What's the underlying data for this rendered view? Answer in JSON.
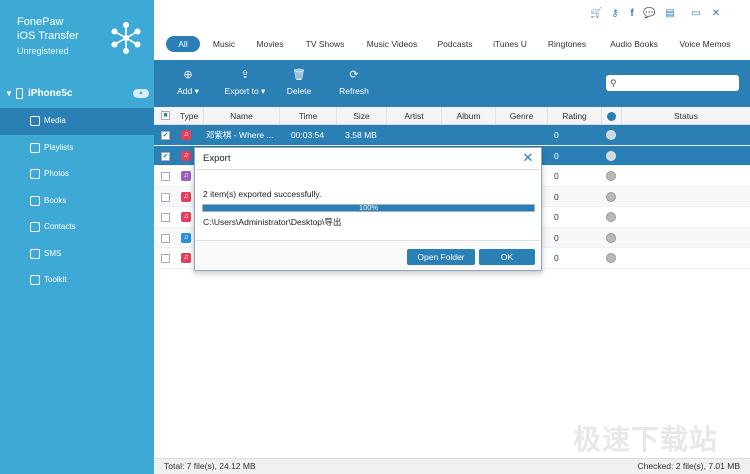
{
  "app": {
    "name_line1": "FonePaw",
    "name_line2": "iOS Transfer",
    "registration": "Unregistered"
  },
  "window_controls": [
    {
      "name": "cart-icon",
      "glyph": "🛒"
    },
    {
      "name": "key-icon",
      "glyph": "⚷"
    },
    {
      "name": "facebook-icon",
      "glyph": "f"
    },
    {
      "name": "chat-icon",
      "glyph": "💬"
    },
    {
      "name": "menu-icon",
      "glyph": "▤"
    },
    {
      "name": "minimize-icon",
      "glyph": "▭"
    },
    {
      "name": "close-window-icon",
      "glyph": "✕"
    }
  ],
  "device": {
    "name": "iPhone5c"
  },
  "sidebar": {
    "items": [
      {
        "label": "Media",
        "icon": "music-icon",
        "active": true
      },
      {
        "label": "Playlists",
        "icon": "playlist-icon",
        "active": false
      },
      {
        "label": "Photos",
        "icon": "photo-icon",
        "active": false
      },
      {
        "label": "Books",
        "icon": "book-icon",
        "active": false
      },
      {
        "label": "Contacts",
        "icon": "contacts-icon",
        "active": false
      },
      {
        "label": "SMS",
        "icon": "sms-icon",
        "active": false
      },
      {
        "label": "Toolkit",
        "icon": "toolkit-icon",
        "active": false
      }
    ]
  },
  "tabs": [
    "All",
    "Music",
    "Movies",
    "TV Shows",
    "Music Videos",
    "Podcasts",
    "iTunes U",
    "Ringtones",
    "Audio Books",
    "Voice Memos"
  ],
  "toolbar": {
    "add": "Add",
    "export": "Export to",
    "delete": "Delete",
    "refresh": "Refresh",
    "search_placeholder": ""
  },
  "table": {
    "columns": [
      "Type",
      "Name",
      "Time",
      "Size",
      "Artist",
      "Album",
      "Genre",
      "Rating",
      "Status"
    ],
    "rows": [
      {
        "selected": true,
        "checked": true,
        "type_color": "#e0405e",
        "name": "邓紫棋 - Where ...",
        "time": "00:03:54",
        "size": "3.58 MB",
        "rating": "0"
      },
      {
        "selected": true,
        "checked": true,
        "type_color": "#e0405e",
        "name": "",
        "time": "",
        "size": "",
        "rating": "0"
      },
      {
        "selected": false,
        "checked": false,
        "type_color": "#9b5fc0",
        "name": "",
        "time": "",
        "size": "",
        "rating": "0"
      },
      {
        "selected": false,
        "checked": false,
        "type_color": "#e0405e",
        "name": "",
        "time": "",
        "size": "",
        "rating": "0"
      },
      {
        "selected": false,
        "checked": false,
        "type_color": "#e0405e",
        "name": "",
        "time": "",
        "size": "",
        "rating": "0"
      },
      {
        "selected": false,
        "checked": false,
        "type_color": "#2a8fd6",
        "name": "",
        "time": "",
        "size": "",
        "rating": "0"
      },
      {
        "selected": false,
        "checked": false,
        "type_color": "#e0405e",
        "name": "",
        "time": "",
        "size": "",
        "rating": "0"
      }
    ]
  },
  "status": {
    "total": "Total: 7 file(s), 24.12 MB",
    "checked": "Checked: 2 file(s), 7.01 MB"
  },
  "dialog": {
    "title": "Export",
    "message": "2 item(s) exported successfully.",
    "progress_label": "100%",
    "progress": 1.0,
    "path": "C:\\Users\\Administrator\\Desktop\\导出",
    "open_folder": "Open Folder",
    "ok": "OK"
  },
  "watermark": "极速下载站",
  "colors": {
    "sidebar": "#3fa9d6",
    "accent": "#2a7fb5"
  }
}
